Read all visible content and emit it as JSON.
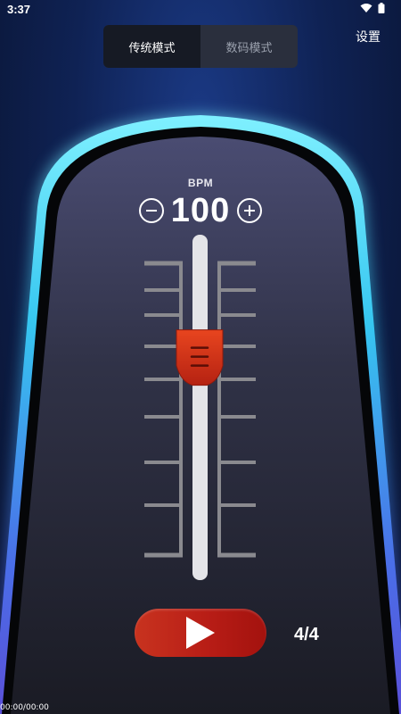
{
  "status_bar": {
    "time": "3:37"
  },
  "mode_toggle": {
    "traditional": "传统模式",
    "digital": "数码模式"
  },
  "header": {
    "settings": "设置"
  },
  "metronome": {
    "bpm_label": "BPM",
    "bpm_value": "100",
    "time_signature": "4/4",
    "slider_level": 0.32
  },
  "footer": {
    "timecode": "00:00/00:00"
  },
  "icons": [
    "wifi-icon",
    "battery-icon",
    "minus-icon",
    "plus-icon",
    "play-icon",
    "grip-icon"
  ],
  "colors": {
    "accent_red": "#c8331f",
    "glow_cyan": "#5fe1ff",
    "glow_blue": "#5a6cff"
  }
}
